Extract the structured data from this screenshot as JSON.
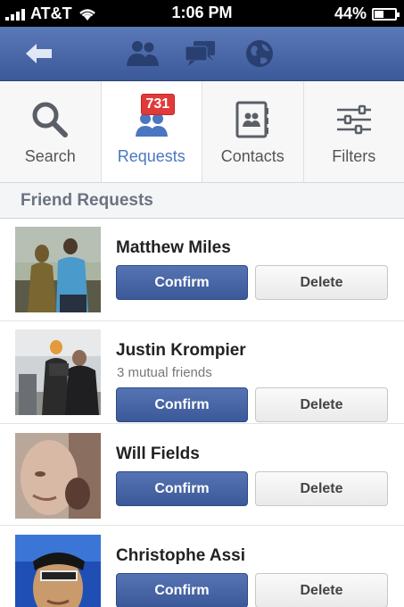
{
  "status_bar": {
    "carrier": "AT&T",
    "time": "1:06 PM",
    "battery": "44%",
    "battery_level": 0.44
  },
  "nav": {
    "icons": [
      "back-arrow-icon",
      "friends-icon",
      "messages-icon",
      "globe-icon"
    ]
  },
  "tabs": [
    {
      "label": "Search",
      "icon": "search-icon"
    },
    {
      "label": "Requests",
      "icon": "friends-icon",
      "badge": "731",
      "active": true
    },
    {
      "label": "Contacts",
      "icon": "contacts-icon"
    },
    {
      "label": "Filters",
      "icon": "filters-icon"
    }
  ],
  "section": {
    "title": "Friend Requests"
  },
  "requests": [
    {
      "name": "Matthew Miles",
      "mutual": "",
      "confirm": "Confirm",
      "delete": "Delete"
    },
    {
      "name": "Justin Krompier",
      "mutual": "3 mutual friends",
      "confirm": "Confirm",
      "delete": "Delete"
    },
    {
      "name": "Will Fields",
      "mutual": "",
      "confirm": "Confirm",
      "delete": "Delete"
    },
    {
      "name": "Christophe Assi",
      "mutual": "",
      "confirm": "Confirm",
      "delete": "Delete"
    }
  ],
  "colors": {
    "brand": "#3b5998",
    "active_tab": "#4a76c2",
    "badge": "#e03b3b"
  }
}
